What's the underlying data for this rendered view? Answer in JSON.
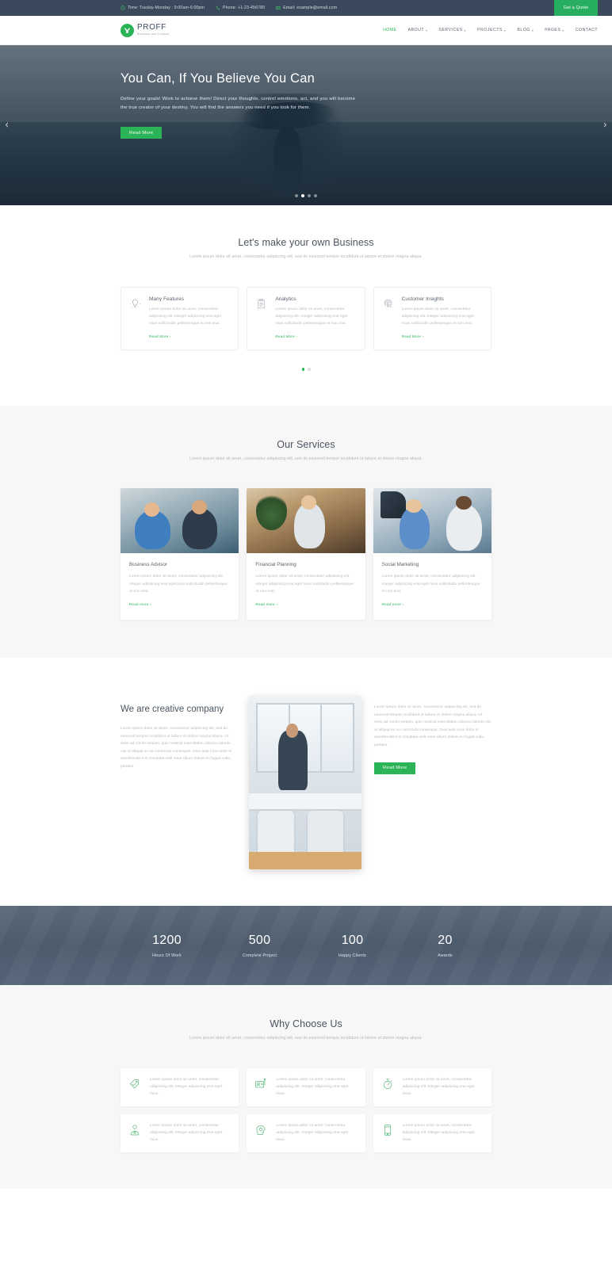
{
  "topbar": {
    "items": [
      {
        "icon": "clock-icon",
        "text": "Time: Tusday-Monday : 9:00am-6:00pm"
      },
      {
        "icon": "phone-icon",
        "text": "Phone: +1-23-456789"
      },
      {
        "icon": "envelope-icon",
        "text": "Email: example@email.com"
      }
    ],
    "quote_label": "Get a Quote"
  },
  "header": {
    "brand": "PROFF",
    "tagline": "Business and Finance",
    "nav": [
      {
        "label": "HOME",
        "caret": "",
        "active": true
      },
      {
        "label": "ABOUT",
        "caret": "▾",
        "active": false
      },
      {
        "label": "SERVICES",
        "caret": "▾",
        "active": false
      },
      {
        "label": "PROJECTS",
        "caret": "▾",
        "active": false
      },
      {
        "label": "BLOG",
        "caret": "▾",
        "active": false
      },
      {
        "label": "PAGES",
        "caret": "▾",
        "active": false
      },
      {
        "label": "CONTACT",
        "caret": "",
        "active": false
      }
    ]
  },
  "hero": {
    "title": "You Can, If You Believe You Can",
    "description": "Define your goals! Work to achieve them! Direct your thoughts, control emotions, act, and you will become the true creator of your destiny. You will find the answers you need if you look for them.",
    "button": "Read More",
    "prev_arrow": "‹",
    "next_arrow": "›",
    "dots": 4,
    "active_dot": 1
  },
  "features": {
    "title": "Let's make your own Business",
    "subtitle": "Lorem ipsum dolor sit amet, consectetur adipiscing elit, sed do eiusmod tempor incididunt ut labore et dolore magna aliqua.",
    "cards": [
      {
        "icon": "lightbulb-icon",
        "title": "Many Features",
        "text": "Lorem ipsum dolor sit amet, consectetur adipiscing elit. Integer adipiscing erat eget risus sollicitudin pellentesque et non erat.",
        "link": "Read More ›"
      },
      {
        "icon": "clipboard-icon",
        "title": "Analytics",
        "text": "Lorem ipsum dolor sit amet, consectetur adipiscing elit. Integer adipiscing erat eget risus sollicitudin pellentesque et non erat.",
        "link": "Read More ›"
      },
      {
        "icon": "fingerprint-icon",
        "title": "Customer Insights",
        "text": "Lorem ipsum dolor sit amet, consectetur adipiscing elit. Integer adipiscing erat eget risus sollicitudin pellentesque et non erat.",
        "link": "Read More ›"
      }
    ],
    "dots": 2,
    "active_dot": 0
  },
  "services": {
    "title": "Our Services",
    "subtitle": "Lorem ipsum dolor sit amet, consectetur adipiscing elit, sed do eiusmod tempor incididunt ut labore et dolore magna aliqua.",
    "cards": [
      {
        "image": "two-businessmen-with-laptop-photo",
        "title": "Business Advisor",
        "text": "Lorem ipsum dolor sit amet, consectetur adipiscing elit. Integer adipiscing erat eget risus sollicitudin pellentesque et non erat.",
        "link": "Read more ›"
      },
      {
        "image": "woman-with-coffee-at-desk-photo",
        "title": "Financial Planning",
        "text": "Lorem ipsum dolor sit amet, consectetur adipiscing elit. Integer adipiscing erat eget risus sollicitudin pellentesque et non erat.",
        "link": "Read more ›"
      },
      {
        "image": "two-colleagues-in-office-photo",
        "title": "Social Marketing",
        "text": "Lorem ipsum dolor sit amet, consectetur adipiscing elit. Integer adipiscing erat eget risus sollicitudin pellentesque et non erat.",
        "link": "Read more ›"
      }
    ]
  },
  "creative": {
    "title": "We are creative company",
    "left_text": "Lorem ipsum dolor sit amet, consectetur adipiscing elit, sed do eiusmod tempor incididunt ut labore et dolore magna aliqua. Ut enim ad minim veniam, quis nostrud exercitation ullamco laboris nisi ut aliquip ex ea commodo consequat. Duis aute irure dolor in reprehenderit in voluptate velit esse cillum dolore eu fugiat nulla pariatur.",
    "image": "man-working-in-modern-office-photo",
    "right_text": "Lorem ipsum dolor sit amet, consectetur adipiscing elit, sed do eiusmod tempor incididunt ut labore et dolore magna aliqua. Ut enim ad minim veniam, quis nostrud exercitation ullamco laboris nisi ut aliquip ex ea commodo consequat. Duis aute irure dolor in reprehenderit in voluptate velit esse cillum dolore eu fugiat nulla pariatur.",
    "button": "Read More"
  },
  "counters": [
    {
      "number": "1200",
      "label": "Hours Of Work"
    },
    {
      "number": "500",
      "label": "Complete Project"
    },
    {
      "number": "100",
      "label": "Happy Clients"
    },
    {
      "number": "20",
      "label": "Awards"
    }
  ],
  "why": {
    "title": "Why Choose Us",
    "subtitle": "Lorem ipsum dolor sit amet, consectetur adipiscing elit, sed do eiusmod tempor incididunt ut labore et dolore magna aliqua.",
    "cards": [
      {
        "icon": "price-tag-icon",
        "text": "Lorem ipsum dolor sit amet, consectetur adipiscing elit. Integer adipiscing erat eget risus."
      },
      {
        "icon": "id-card-icon",
        "text": "Lorem ipsum dolor sit amet, consectetur adipiscing elit. Integer adipiscing erat eget risus."
      },
      {
        "icon": "stopwatch-icon",
        "text": "Lorem ipsum dolor sit amet, consectetur adipiscing elit. Integer adipiscing erat eget risus."
      },
      {
        "icon": "businessman-icon",
        "text": "Lorem ipsum dolor sit amet, consectetur adipiscing elit. Integer adipiscing erat eget risus."
      },
      {
        "icon": "head-gear-icon",
        "text": "Lorem ipsum dolor sit amet, consectetur adipiscing elit. Integer adipiscing erat eget risus."
      },
      {
        "icon": "mobile-phone-icon",
        "text": "Lorem ipsum dolor sit amet, consectetur adipiscing elit. Integer adipiscing erat eget risus."
      }
    ]
  },
  "colors": {
    "accent_green": "#2bb457",
    "dark_navy": "#3a4a5c",
    "counter_bg": "#4e5d6e",
    "muted_text": "#b6bcc3"
  }
}
